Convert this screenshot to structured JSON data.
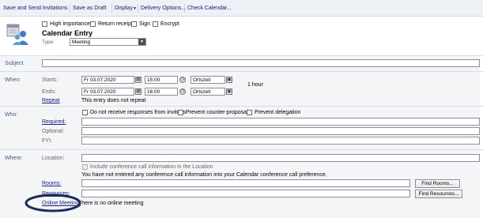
{
  "toolbar": {
    "save_send": "Save and Send Invitations",
    "save_draft": "Save as Draft",
    "display": "Display",
    "delivery_options": "Delivery Options...",
    "check_calendar": "Check Calendar..."
  },
  "header": {
    "high_importance": "High importance",
    "return_receipt": "Return receipt",
    "sign": "Sign",
    "encrypt": "Encrypt",
    "title": "Calendar Entry",
    "type_label": "Type:",
    "type_value": "Meeting"
  },
  "subject": {
    "label": "Subject"
  },
  "when": {
    "label": "When:",
    "starts_label": "Starts:",
    "start_date": "Fr 03.07.2020",
    "start_time": "15:00",
    "start_zone": "Ortszeit",
    "ends_label": "Ends:",
    "end_date": "Fr 03.07.2020",
    "end_time": "16:00",
    "end_zone": "Ortszeit",
    "duration": "1 hour",
    "repeat_label": "Repeat",
    "repeat_text": "This entry does not repeat"
  },
  "who": {
    "label": "Who:",
    "no_responses": "Do not receive responses from invitees",
    "prevent_counter": "Prevent counter-proposals",
    "prevent_delegation": "Prevent delegation",
    "required": "Required:",
    "optional": "Optional:",
    "fyi": "FYI:"
  },
  "where": {
    "label": "Where:",
    "location": "Location:",
    "include_conf": "Include conference call information in the Location",
    "conf_note": "You have not entered any conference call information into your Calendar conference call preference.",
    "rooms": "Rooms:",
    "find_rooms": "Find Rooms...",
    "resources": "Resources:",
    "find_resources": "Find Resources...",
    "online_meeting": "Online Meeting:",
    "online_meeting_text": "There is no online meeting"
  },
  "colors": {
    "accent_link": "#1a237e",
    "section_label": "#3b5a9c",
    "highlight_ellipse": "#1c2a5c"
  }
}
